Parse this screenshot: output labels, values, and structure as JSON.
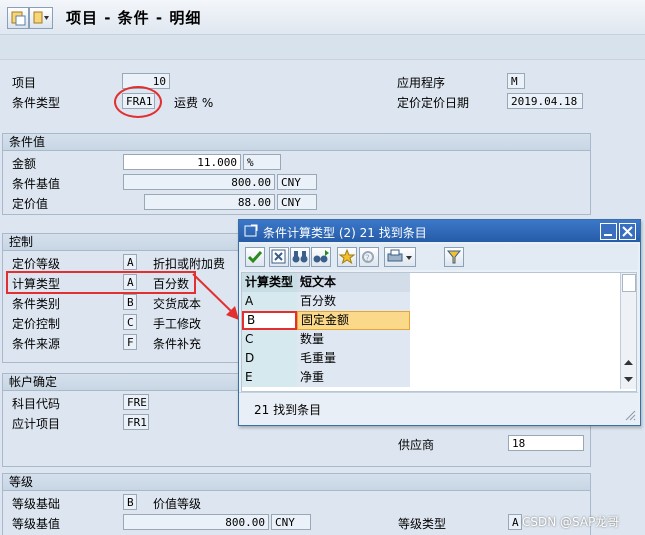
{
  "window": {
    "title": "项目 - 条件 - 明细"
  },
  "header": {
    "item_label": "项目",
    "item_value": "10",
    "cond_type_label": "条件类型",
    "cond_type_value": "FRA1",
    "cond_type_desc": "运费 %",
    "application_label": "应用程序",
    "application_value": "M",
    "pricing_date_label": "定价定价日期",
    "pricing_date_value": "2019.04.18"
  },
  "condition_values": {
    "group_title": "条件值",
    "amount_label": "金额",
    "amount_value": "11.000",
    "amount_unit": "%",
    "base_label": "条件基值",
    "base_value": "800.00",
    "base_currency": "CNY",
    "pricing_value_label": "定价值",
    "pricing_value": "88.00",
    "pricing_currency": "CNY"
  },
  "control": {
    "group_title": "控制",
    "rows": [
      {
        "label": "定价等级",
        "code": "A",
        "desc": "折扣或附加费"
      },
      {
        "label": "计算类型",
        "code": "A",
        "desc": "百分数"
      },
      {
        "label": "条件类别",
        "code": "B",
        "desc": "交货成本"
      },
      {
        "label": "定价控制",
        "code": "C",
        "desc": "手工修改"
      },
      {
        "label": "条件来源",
        "code": "F",
        "desc": "条件补充"
      }
    ]
  },
  "account": {
    "group_title": "帐户确定",
    "gl_label": "科目代码",
    "gl_value": "FRE",
    "accrual_label": "应计项目",
    "accrual_value": "FR1",
    "vendor_label": "供应商",
    "vendor_value": "18"
  },
  "scale": {
    "group_title": "等级",
    "basis_label": "等级基础",
    "basis_code": "B",
    "basis_desc": "价值等级",
    "value_label": "等级基值",
    "value_value": "800.00",
    "value_currency": "CNY",
    "type_label": "等级类型",
    "type_value": "A"
  },
  "popup": {
    "title": "条件计算类型 (2)  21 找到条目",
    "col_code": "计算类型",
    "col_text": "短文本",
    "rows": [
      {
        "code": "A",
        "text": "百分数"
      },
      {
        "code": "B",
        "text": "固定金额"
      },
      {
        "code": "C",
        "text": "数量"
      },
      {
        "code": "D",
        "text": "毛重量"
      },
      {
        "code": "E",
        "text": "净重"
      }
    ],
    "status": "21 找到条目"
  },
  "watermark": "CSDN @SAP龙哥",
  "colors": {
    "highlight_row": "#fbd98b",
    "annotation_red": "#e23030",
    "popup_title": "#2f67b6"
  }
}
